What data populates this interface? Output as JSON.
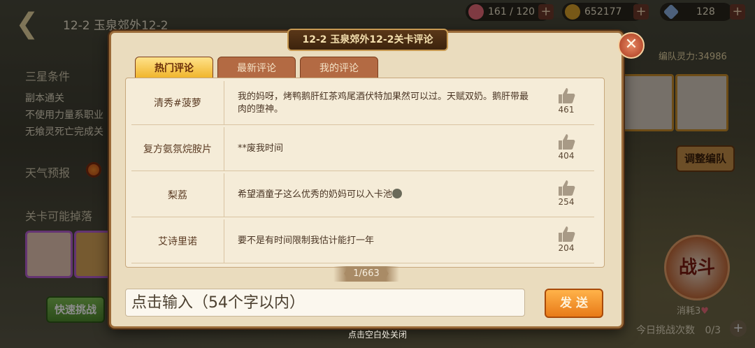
{
  "header": {
    "stage_title": "12-2 玉泉郊外12-2",
    "resources": [
      {
        "name": "stamina",
        "icon": "heart-icon",
        "value": "161 / 120",
        "color": "#e86a78"
      },
      {
        "name": "gold",
        "icon": "coin-icon",
        "value": "652177",
        "color": "#d9a02a"
      },
      {
        "name": "crystal",
        "icon": "crystal-icon",
        "value": "128",
        "color": "#8ab0e0"
      }
    ]
  },
  "left_panel": {
    "three_star_heading": "三星条件",
    "conditions": [
      "副本通关",
      "不使用力量系职业",
      "无飨灵死亡完成关"
    ],
    "weather_label": "天气预报",
    "drops_heading": "关卡可能掉落",
    "quick_battle": "快速挑战"
  },
  "right_panel": {
    "team_power": "编队灵力:34986",
    "adjust_team": "调整编队",
    "battle": "战斗",
    "consume": "消耗3",
    "today_label": "今日挑战次数",
    "today_value": "0/3"
  },
  "modal": {
    "title": "12-2 玉泉郊外12-2关卡评论",
    "tabs": [
      "热门评论",
      "最新评论",
      "我的评论"
    ],
    "comments": [
      {
        "user": "清秀#菠萝",
        "text": "我的妈呀，烤鸭鹅肝红茶鸡尾酒伏特加果然可以过。天赋双奶。鹅肝带最肉的堕神。",
        "likes": "461"
      },
      {
        "user": "复方氨氛烷胺片",
        "text": "**废我时间",
        "likes": "404"
      },
      {
        "user": "梨荔",
        "text": "希望酒童子这么优秀的奶妈可以入卡池",
        "likes": "254"
      },
      {
        "user": "艾诗里诺",
        "text": "要不是有时间限制我估计能打一年",
        "likes": "204"
      }
    ],
    "pager": "1/663",
    "input_placeholder": "点击输入（54个字以内）",
    "send_label": "发 送"
  },
  "close_hint": "点击空白处关闭",
  "colors": {
    "accent": "#f0b42a",
    "panel": "#eadcbe",
    "border": "#9a6b3a"
  }
}
